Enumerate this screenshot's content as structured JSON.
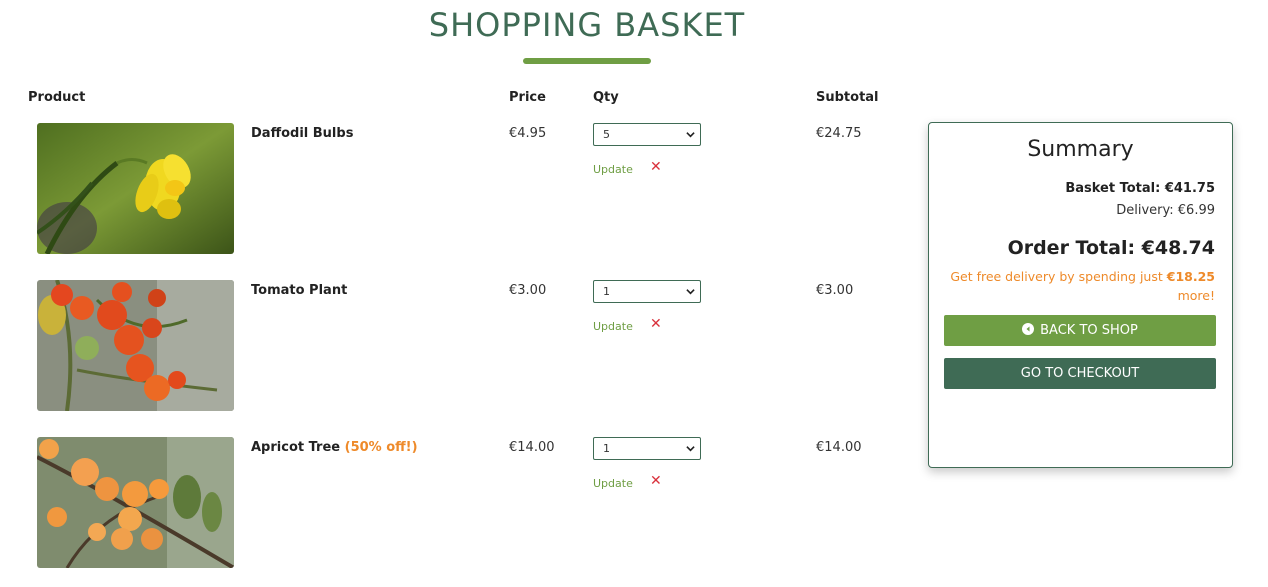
{
  "page": {
    "title": "SHOPPING BASKET"
  },
  "columns": {
    "product": "Product",
    "price": "Price",
    "qty": "Qty",
    "subtotal": "Subtotal"
  },
  "items": [
    {
      "name": "Daffodil Bulbs",
      "promo": "",
      "price": "€4.95",
      "qty": "5",
      "update": "Update",
      "remove_icon": "close-icon",
      "subtotal": "€24.75"
    },
    {
      "name": "Tomato Plant",
      "promo": "",
      "price": "€3.00",
      "qty": "1",
      "update": "Update",
      "remove_icon": "close-icon",
      "subtotal": "€3.00"
    },
    {
      "name": "Apricot Tree",
      "promo": "(50% off!)",
      "price": "€14.00",
      "qty": "1",
      "update": "Update",
      "remove_icon": "close-icon",
      "subtotal": "€14.00"
    }
  ],
  "summary": {
    "title": "Summary",
    "basket_total": "Basket Total: €41.75",
    "delivery": "Delivery: €6.99",
    "order_total": "Order Total: €48.74",
    "free_delivery_prefix": "Get free delivery by spending just",
    "free_delivery_amount": "€18.25",
    "free_delivery_suffix": "more!",
    "back_button": "BACK TO SHOP",
    "checkout_button": "GO TO CHECKOUT"
  },
  "colors": {
    "brand_green": "#3f6b55",
    "accent_green": "#6f9e44",
    "promo_orange": "#ee8a2a",
    "remove_red": "#d9313c"
  }
}
